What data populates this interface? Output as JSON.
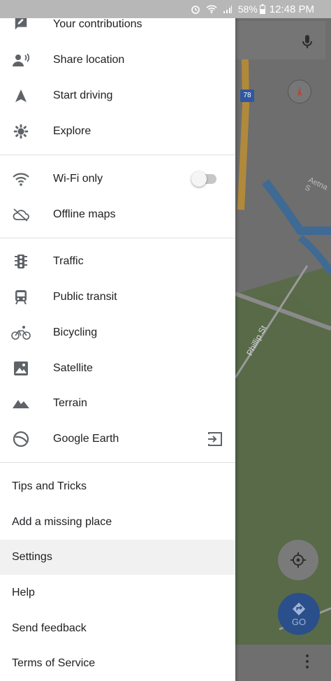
{
  "status_bar": {
    "battery": "58%",
    "time": "12:48 PM"
  },
  "map": {
    "highway_shield": "78",
    "street_label_1": "Phillip St",
    "street_label_2": "Aetna S",
    "go_label": "GO"
  },
  "menu": {
    "group1": [
      {
        "label": "Your contributions",
        "icon": "contributions-icon"
      },
      {
        "label": "Share location",
        "icon": "share-location-icon"
      },
      {
        "label": "Start driving",
        "icon": "navigation-arrow-icon"
      },
      {
        "label": "Explore",
        "icon": "explore-icon"
      }
    ],
    "group2": [
      {
        "label": "Wi-Fi only",
        "icon": "wifi-icon",
        "toggle": false
      },
      {
        "label": "Offline maps",
        "icon": "offline-cloud-icon"
      }
    ],
    "group3": [
      {
        "label": "Traffic",
        "icon": "traffic-light-icon"
      },
      {
        "label": "Public transit",
        "icon": "train-icon"
      },
      {
        "label": "Bicycling",
        "icon": "bicycle-icon"
      },
      {
        "label": "Satellite",
        "icon": "satellite-image-icon"
      },
      {
        "label": "Terrain",
        "icon": "terrain-mountain-icon"
      },
      {
        "label": "Google Earth",
        "icon": "earth-icon"
      }
    ],
    "group4": [
      {
        "label": "Tips and Tricks"
      },
      {
        "label": "Add a missing place"
      },
      {
        "label": "Settings",
        "selected": true
      },
      {
        "label": "Help"
      },
      {
        "label": "Send feedback"
      },
      {
        "label": "Terms of Service"
      }
    ]
  },
  "colors": {
    "accent_blue": "#1a73e8",
    "icon_gray": "#5f6368"
  }
}
